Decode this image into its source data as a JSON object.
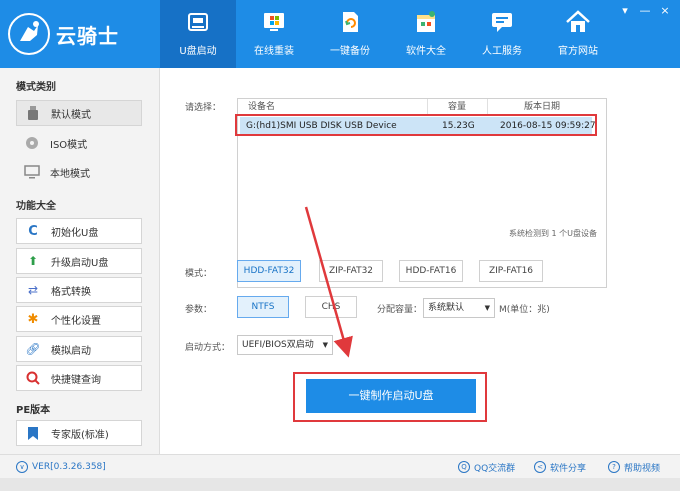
{
  "app": {
    "logo_text": "云骑士"
  },
  "nav": [
    {
      "label": "U盘启动",
      "icon": "usb-icon",
      "active": true
    },
    {
      "label": "在线重装",
      "icon": "windows-icon"
    },
    {
      "label": "一键备份",
      "icon": "backup-icon"
    },
    {
      "label": "软件大全",
      "icon": "software-icon"
    },
    {
      "label": "人工服务",
      "icon": "chat-icon"
    },
    {
      "label": "官方网站",
      "icon": "home-icon"
    }
  ],
  "window_controls": {
    "menu": "▾",
    "minimize": "—",
    "close": "×"
  },
  "sidebar": {
    "mode_title": "模式类别",
    "modes": [
      {
        "label": "默认模式",
        "icon": "usb-drive-icon",
        "selected": true
      },
      {
        "label": "ISO模式",
        "icon": "disc-icon"
      },
      {
        "label": "本地模式",
        "icon": "monitor-icon"
      }
    ],
    "func_title": "功能大全",
    "funcs": [
      {
        "label": "初始化U盘",
        "icon": "refresh-icon"
      },
      {
        "label": "升级启动U盘",
        "icon": "upgrade-arrow-icon"
      },
      {
        "label": "格式转换",
        "icon": "convert-icon"
      },
      {
        "label": "个性化设置",
        "icon": "gear-icon"
      },
      {
        "label": "模拟启动",
        "icon": "link-icon"
      },
      {
        "label": "快捷键查询",
        "icon": "search-icon"
      }
    ],
    "pe_title": "PE版本",
    "pe_item": {
      "label": "专家版(标准)",
      "icon": "bookmark-icon"
    }
  },
  "main": {
    "select_label": "请选择：",
    "table": {
      "headers": [
        "设备名",
        "容量",
        "版本日期"
      ],
      "rows": [
        [
          "G:(hd1)SMI USB DISK USB Device",
          "15.23G",
          "2016-08-15 09:59:27"
        ]
      ]
    },
    "detect_text": "系统检测到 1 个U盘设备",
    "mode_label": "模式：",
    "mode_options": [
      "HDD-FAT32",
      "ZIP-FAT32",
      "HDD-FAT16",
      "ZIP-FAT16"
    ],
    "mode_selected": "HDD-FAT32",
    "param_label": "参数：",
    "fs_options": [
      "NTFS",
      "CHS"
    ],
    "alloc_label": "分配容量：",
    "alloc_value": "系统默认",
    "alloc_unit": "M(单位：兆)",
    "boot_label": "启动方式：",
    "boot_value": "UEFI/BIOS双启动",
    "make_button": "一键制作启动U盘"
  },
  "status": {
    "version": "VER[0.3.26.358]",
    "qq": "QQ交流群",
    "share": "软件分享",
    "help": "帮助视频"
  },
  "colors": {
    "brand": "#1e8ce6",
    "highlight": "#e0393c",
    "row_selected": "#cce4f7"
  }
}
